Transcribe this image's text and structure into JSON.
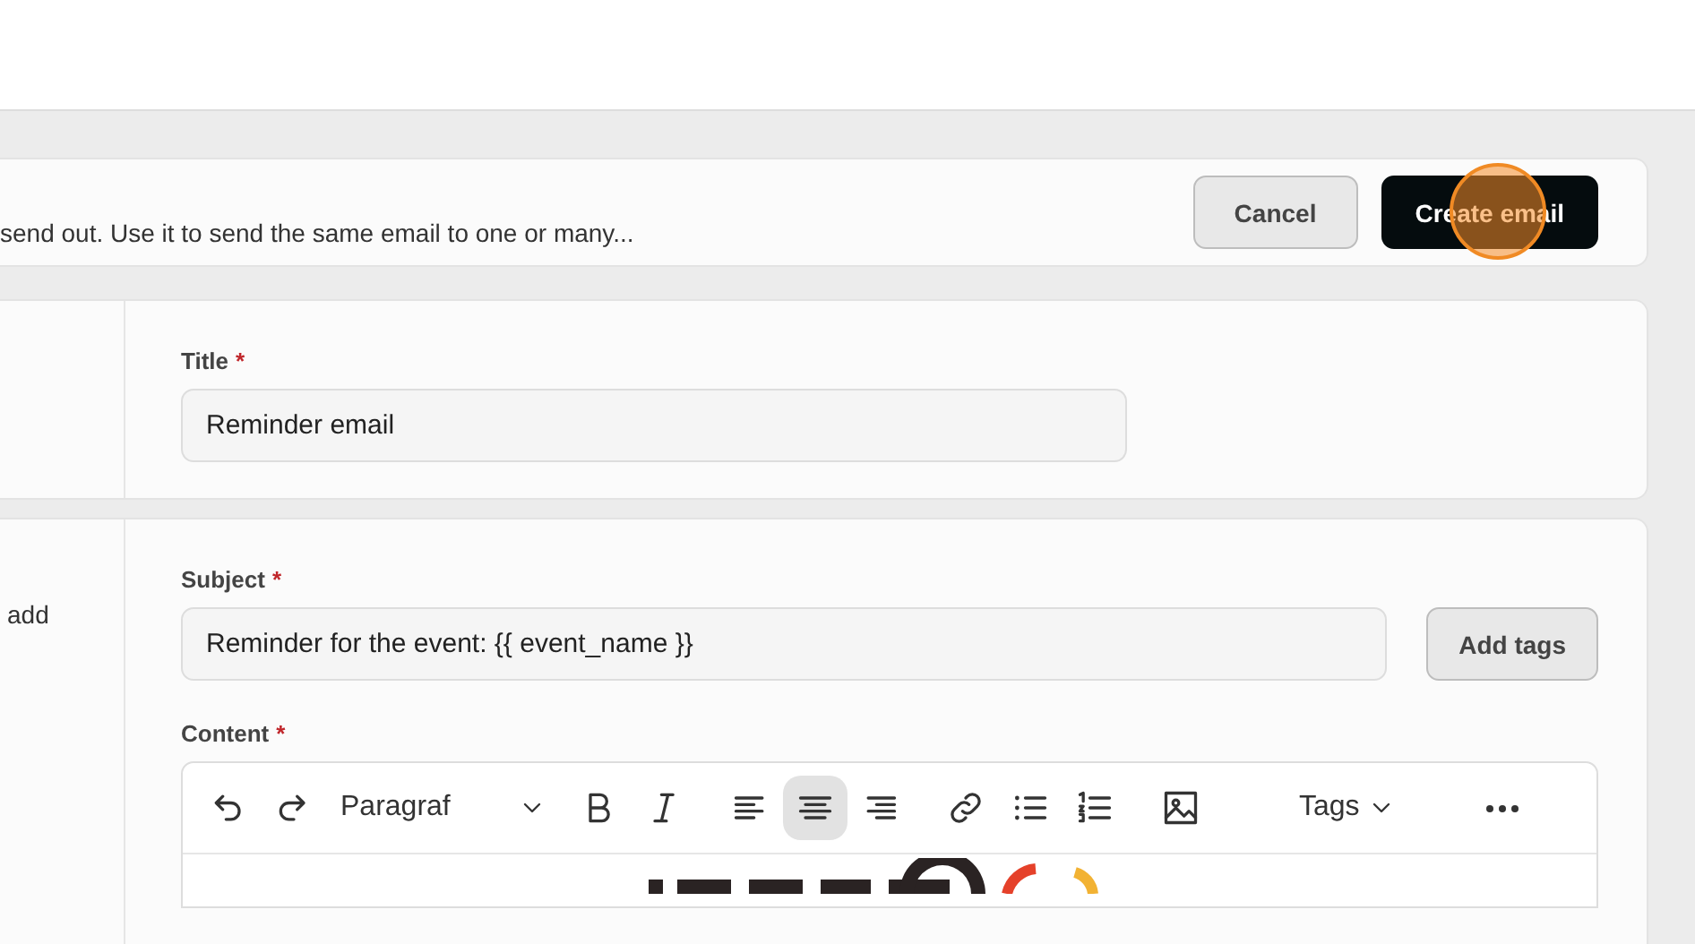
{
  "header": {
    "description": "send out. Use it to send the same email to one or many...",
    "buttons": [
      {
        "label": "Cancel",
        "kind": "secondary"
      },
      {
        "label": "Create email",
        "kind": "primary"
      }
    ]
  },
  "title_section": {
    "label": "Title",
    "required_mark": "*",
    "value": "Reminder email"
  },
  "content_section": {
    "side_text": "add",
    "subject": {
      "label": "Subject",
      "required_mark": "*",
      "value": "Reminder for the event: {{ event_name }}"
    },
    "add_tags_button": "Add tags",
    "content_label": "Content",
    "content_required_mark": "*",
    "toolbar": [
      {
        "kind": "undo",
        "selected": false
      },
      {
        "kind": "redo",
        "selected": false
      },
      {
        "kind": "dropdown",
        "label": "Paragraf",
        "selected": false
      },
      {
        "kind": "bold",
        "selected": false
      },
      {
        "kind": "italic",
        "selected": false
      },
      {
        "kind": "align-left",
        "selected": false
      },
      {
        "kind": "align-center",
        "selected": true
      },
      {
        "kind": "align-right",
        "selected": false
      },
      {
        "kind": "link",
        "selected": false
      },
      {
        "kind": "bullet-list",
        "selected": false
      },
      {
        "kind": "numbered-list",
        "selected": false
      },
      {
        "kind": "image",
        "selected": false
      },
      {
        "kind": "tags",
        "label": "Tags",
        "selected": false
      },
      {
        "kind": "more",
        "selected": false
      }
    ]
  }
}
